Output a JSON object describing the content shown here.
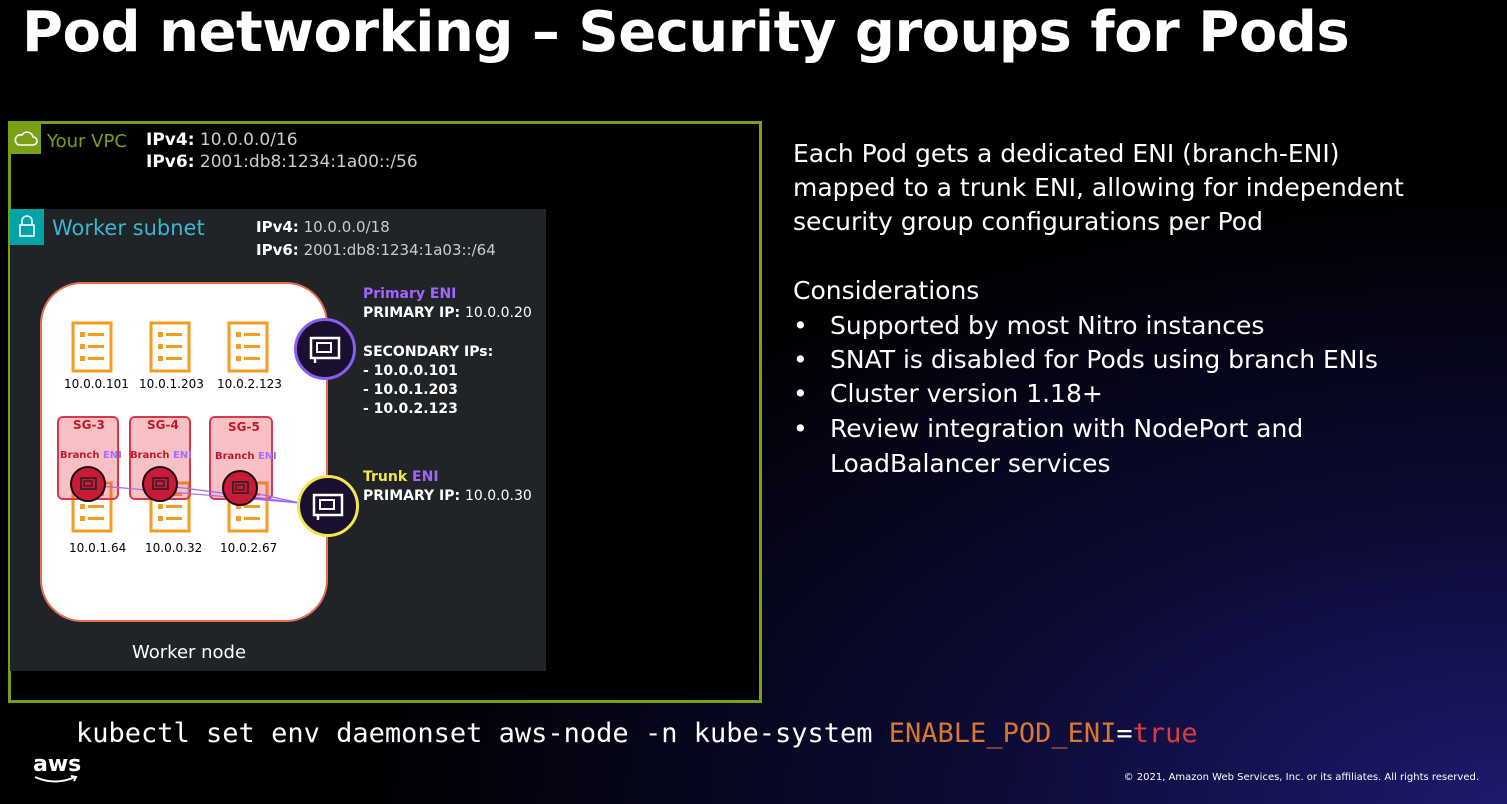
{
  "title": "Pod networking – Security groups for Pods",
  "vpc": {
    "name": "Your VPC",
    "ipv4_label": "IPv4:",
    "ipv4": "10.0.0.0/16",
    "ipv6_label": "IPv6:",
    "ipv6": "2001:db8:1234:1a00::/56"
  },
  "subnet": {
    "name": "Worker subnet",
    "ipv4_label": "IPv4:",
    "ipv4": "10.0.0.0/18",
    "ipv6_label": "IPv6:",
    "ipv6": "2001:db8:1234:1a03::/64"
  },
  "node": {
    "label": "Worker node"
  },
  "pods_top": [
    "10.0.0.101",
    "10.0.1.203",
    "10.0.2.123"
  ],
  "pods_bottom": [
    "10.0.1.64",
    "10.0.0.32",
    "10.0.2.67"
  ],
  "security_groups": [
    {
      "name": "SG-3",
      "branch": "Branch",
      "eni": "ENI"
    },
    {
      "name": "SG-4",
      "branch": "Branch",
      "eni": "ENI"
    },
    {
      "name": "SG-5",
      "branch": "Branch",
      "eni": "ENI"
    }
  ],
  "primary_eni": {
    "title": "Primary ENI",
    "ip_label": "PRIMARY IP:",
    "ip": "10.0.0.20",
    "secondary_label": "SECONDARY IPs:",
    "secondary": [
      "- 10.0.0.101",
      "- 10.0.1.203",
      "- 10.0.2.123"
    ]
  },
  "trunk_eni": {
    "title_a": "Trunk",
    "title_b": "ENI",
    "ip_label": "PRIMARY IP:",
    "ip": "10.0.0.30"
  },
  "description": [
    "Each Pod gets a dedicated ENI (branch-ENI)",
    "mapped to a trunk ENI, allowing for independent",
    "security group configurations per Pod"
  ],
  "considerations_title": "Considerations",
  "considerations": [
    "Supported by most Nitro instances",
    "SNAT is disabled for Pods using branch ENIs",
    "Cluster version 1.18+",
    "Review integration with NodePort and",
    "LoadBalancer services"
  ],
  "bullet_char": "•",
  "command": {
    "prefix": "kubectl set env daemonset aws-node -n kube-system ",
    "env": "ENABLE_POD_ENI",
    "eq": "=",
    "value": "true"
  },
  "logo": "aws",
  "copyright": "© 2021, Amazon Web Services, Inc. or its affiliates. All rights reserved.",
  "colors": {
    "vpc_border": "#7aa116",
    "subnet_tag": "#00a4a6",
    "primary_eni": "#a066ff",
    "trunk": "#f2e84b",
    "env_var": "#d9782e",
    "env_value": "#e03a3a"
  },
  "icons": [
    "cloud-icon",
    "lock-icon",
    "pod-icon",
    "network-interface-icon"
  ]
}
